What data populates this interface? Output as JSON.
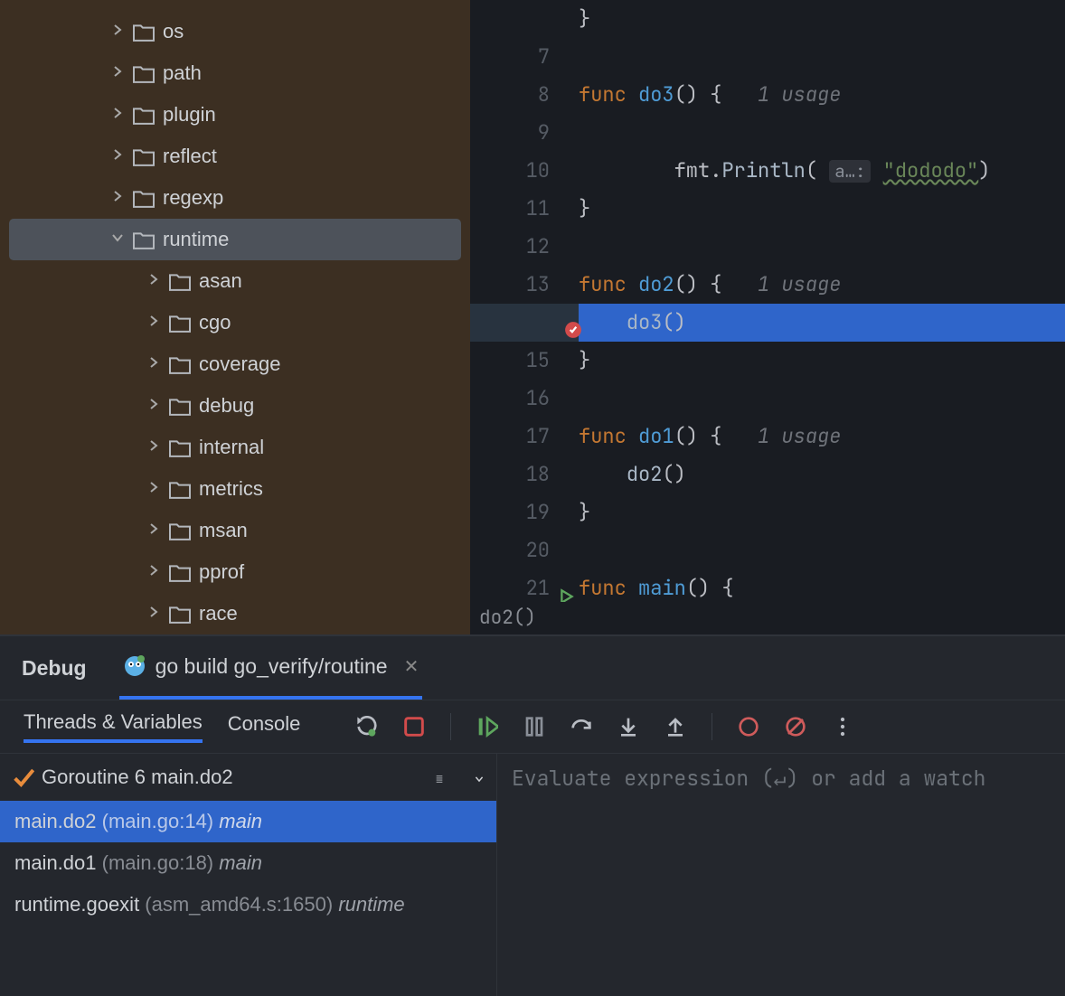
{
  "tree": {
    "items": [
      {
        "name": "os",
        "depth": 3,
        "expanded": false,
        "selected": false
      },
      {
        "name": "path",
        "depth": 3,
        "expanded": false,
        "selected": false
      },
      {
        "name": "plugin",
        "depth": 3,
        "expanded": false,
        "selected": false
      },
      {
        "name": "reflect",
        "depth": 3,
        "expanded": false,
        "selected": false
      },
      {
        "name": "regexp",
        "depth": 3,
        "expanded": false,
        "selected": false
      },
      {
        "name": "runtime",
        "depth": 3,
        "expanded": true,
        "selected": true
      },
      {
        "name": "asan",
        "depth": 4,
        "expanded": false,
        "selected": false
      },
      {
        "name": "cgo",
        "depth": 4,
        "expanded": false,
        "selected": false
      },
      {
        "name": "coverage",
        "depth": 4,
        "expanded": false,
        "selected": false
      },
      {
        "name": "debug",
        "depth": 4,
        "expanded": false,
        "selected": false
      },
      {
        "name": "internal",
        "depth": 4,
        "expanded": false,
        "selected": false
      },
      {
        "name": "metrics",
        "depth": 4,
        "expanded": false,
        "selected": false
      },
      {
        "name": "msan",
        "depth": 4,
        "expanded": false,
        "selected": false
      },
      {
        "name": "pprof",
        "depth": 4,
        "expanded": false,
        "selected": false
      },
      {
        "name": "race",
        "depth": 4,
        "expanded": false,
        "selected": false
      }
    ]
  },
  "editor": {
    "breadcrumb": "do2()",
    "lines": [
      {
        "n": "",
        "t": "brace",
        "text": "}"
      },
      {
        "n": "7",
        "t": "blank"
      },
      {
        "n": "8",
        "t": "func",
        "kw": "func",
        "name": "do3",
        "sig": "() {",
        "usages": "1 usage"
      },
      {
        "n": "9",
        "t": "blank"
      },
      {
        "n": "10",
        "t": "println",
        "indent": "        ",
        "pkg": "fmt",
        "call": "Println",
        "hint": "a…:",
        "str": "\"dododo\"",
        "tail": ")"
      },
      {
        "n": "11",
        "t": "brace",
        "text": "}"
      },
      {
        "n": "12",
        "t": "blank"
      },
      {
        "n": "13",
        "t": "func",
        "kw": "func",
        "name": "do2",
        "sig": "() {",
        "usages": "1 usage"
      },
      {
        "n": "",
        "t": "call",
        "indent": "    ",
        "call": "do3",
        "tail": "()",
        "bp": true,
        "current": true
      },
      {
        "n": "15",
        "t": "brace",
        "text": "}"
      },
      {
        "n": "16",
        "t": "blank"
      },
      {
        "n": "17",
        "t": "func",
        "kw": "func",
        "name": "do1",
        "sig": "() {",
        "usages": "1 usage"
      },
      {
        "n": "18",
        "t": "call",
        "indent": "    ",
        "call": "do2",
        "tail": "()"
      },
      {
        "n": "19",
        "t": "brace",
        "text": "}"
      },
      {
        "n": "20",
        "t": "blank"
      },
      {
        "n": "21",
        "t": "func",
        "kw": "func",
        "name": "main",
        "sig": "() {",
        "run": true
      }
    ]
  },
  "debug": {
    "title": "Debug",
    "run_config": "go build go_verify/routine",
    "subtabs": {
      "threads": "Threads & Variables",
      "console": "Console"
    },
    "thread": "Goroutine 6 main.do2",
    "frames": [
      {
        "fn": "main.do2",
        "loc": "(main.go:14)",
        "mod": "main",
        "selected": true
      },
      {
        "fn": "main.do1",
        "loc": "(main.go:18)",
        "mod": "main",
        "selected": false
      },
      {
        "fn": "runtime.goexit",
        "loc": "(asm_amd64.s:1650)",
        "mod": "runtime",
        "selected": false
      }
    ],
    "watch_placeholder": "Evaluate expression (↵) or add a watch",
    "watch_hint_key": "↵"
  }
}
